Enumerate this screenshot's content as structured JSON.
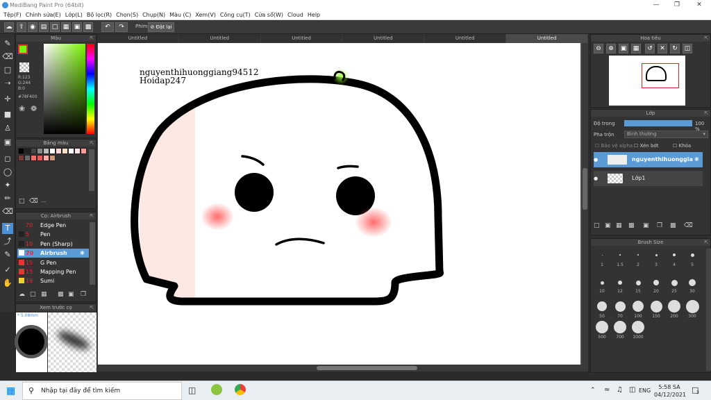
{
  "window": {
    "title": "MediBang Paint Pro (64bit)"
  },
  "menu": [
    "Tệp(F)",
    "Chỉnh sửa(E)",
    "Lớp(L)",
    "Bộ lọc(R)",
    "Chọn(S)",
    "Chụp(N)",
    "Màu (C)",
    "Xem(V)",
    "Công cụ(T)",
    "Cửa sổ(W)",
    "Cloud",
    "Help"
  ],
  "toolbar": {
    "phim_label": "Phím",
    "reset_label": "Đặt lại"
  },
  "color_panel": {
    "title": "Màu",
    "r": "R:123",
    "g": "G:244",
    "b": "B:0",
    "hex": "#78F400",
    "primary": "#78f400"
  },
  "palette_panel": {
    "title": "Bảng màu",
    "footer": "---",
    "swatches": [
      "#000000",
      "#222222",
      "#444444",
      "#888888",
      "#bbbbbb",
      "#ffffff",
      "#ffd7d7",
      "#ffe0c0",
      "#ffffff",
      "#ffe6e6",
      "#ff9999",
      "#7a3b3b",
      "#6a6a6a",
      "#ff6a6a",
      "#ee5555",
      "#ffaaaa",
      "#cc9977"
    ]
  },
  "brush_panel": {
    "title": "Cọ: Airbrush",
    "brushes": [
      {
        "size": "70",
        "name": "Edge Pen",
        "color": "#333333"
      },
      {
        "size": "5",
        "name": "Pen",
        "color": "#222222"
      },
      {
        "size": "10",
        "name": "Pen (Sharp)",
        "color": "#222222"
      },
      {
        "size": "70",
        "name": "Airbrush",
        "color": "#ffffff"
      },
      {
        "size": "15",
        "name": "G Pen",
        "color": "#e8352f"
      },
      {
        "size": "15",
        "name": "Mapping Pen",
        "color": "#e8352f"
      },
      {
        "size": "19",
        "name": "Sumi",
        "color": "#f2d12c"
      }
    ]
  },
  "preview_panel": {
    "title": "Xem trước cọ",
    "size_label": "5.08mm"
  },
  "tabs": [
    "Untitled",
    "Untitled",
    "Untitled",
    "Untitled",
    "Untitled",
    "Untitled"
  ],
  "canvas": {
    "line1": "nguyenthihuonggiang94512",
    "line2": "Hoidap247"
  },
  "navigator": {
    "title": "Hoa tiêu"
  },
  "layer_panel": {
    "title": "Lớp",
    "opacity_label": "Độ trong",
    "opacity_value": "100 %",
    "opacity_fraction": 1.0,
    "blend_label": "Pha trộn",
    "blend_value": "Bình thường",
    "alpha_label": "Bảo vệ alpha",
    "clip_label": "Xén bớt",
    "lock_label": "Khóa",
    "layers": [
      {
        "name": "nguyenthihuonggiang94512"
      },
      {
        "name": "Lớp1"
      }
    ]
  },
  "brushsize_panel": {
    "title": "Brush Size",
    "sizes": [
      "1",
      "1.5",
      "2",
      "3",
      "4",
      "5",
      "10",
      "12",
      "15",
      "20",
      "25",
      "30",
      "50",
      "70",
      "100",
      "150",
      "200",
      "300",
      "500",
      "700",
      "1000"
    ]
  },
  "taskbar": {
    "search_placeholder": "Nhập tại đây để tìm kiếm",
    "lang": "ENG",
    "time": "5:58 SA",
    "date": "04/12/2021",
    "notif": "3"
  }
}
